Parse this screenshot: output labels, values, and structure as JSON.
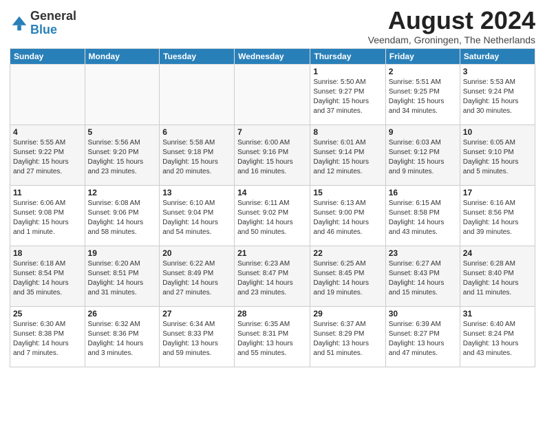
{
  "header": {
    "logo_line1": "General",
    "logo_line2": "Blue",
    "title": "August 2024",
    "subtitle": "Veendam, Groningen, The Netherlands"
  },
  "weekdays": [
    "Sunday",
    "Monday",
    "Tuesday",
    "Wednesday",
    "Thursday",
    "Friday",
    "Saturday"
  ],
  "weeks": [
    [
      {
        "day": "",
        "info": ""
      },
      {
        "day": "",
        "info": ""
      },
      {
        "day": "",
        "info": ""
      },
      {
        "day": "",
        "info": ""
      },
      {
        "day": "1",
        "info": "Sunrise: 5:50 AM\nSunset: 9:27 PM\nDaylight: 15 hours\nand 37 minutes."
      },
      {
        "day": "2",
        "info": "Sunrise: 5:51 AM\nSunset: 9:25 PM\nDaylight: 15 hours\nand 34 minutes."
      },
      {
        "day": "3",
        "info": "Sunrise: 5:53 AM\nSunset: 9:24 PM\nDaylight: 15 hours\nand 30 minutes."
      }
    ],
    [
      {
        "day": "4",
        "info": "Sunrise: 5:55 AM\nSunset: 9:22 PM\nDaylight: 15 hours\nand 27 minutes."
      },
      {
        "day": "5",
        "info": "Sunrise: 5:56 AM\nSunset: 9:20 PM\nDaylight: 15 hours\nand 23 minutes."
      },
      {
        "day": "6",
        "info": "Sunrise: 5:58 AM\nSunset: 9:18 PM\nDaylight: 15 hours\nand 20 minutes."
      },
      {
        "day": "7",
        "info": "Sunrise: 6:00 AM\nSunset: 9:16 PM\nDaylight: 15 hours\nand 16 minutes."
      },
      {
        "day": "8",
        "info": "Sunrise: 6:01 AM\nSunset: 9:14 PM\nDaylight: 15 hours\nand 12 minutes."
      },
      {
        "day": "9",
        "info": "Sunrise: 6:03 AM\nSunset: 9:12 PM\nDaylight: 15 hours\nand 9 minutes."
      },
      {
        "day": "10",
        "info": "Sunrise: 6:05 AM\nSunset: 9:10 PM\nDaylight: 15 hours\nand 5 minutes."
      }
    ],
    [
      {
        "day": "11",
        "info": "Sunrise: 6:06 AM\nSunset: 9:08 PM\nDaylight: 15 hours\nand 1 minute."
      },
      {
        "day": "12",
        "info": "Sunrise: 6:08 AM\nSunset: 9:06 PM\nDaylight: 14 hours\nand 58 minutes."
      },
      {
        "day": "13",
        "info": "Sunrise: 6:10 AM\nSunset: 9:04 PM\nDaylight: 14 hours\nand 54 minutes."
      },
      {
        "day": "14",
        "info": "Sunrise: 6:11 AM\nSunset: 9:02 PM\nDaylight: 14 hours\nand 50 minutes."
      },
      {
        "day": "15",
        "info": "Sunrise: 6:13 AM\nSunset: 9:00 PM\nDaylight: 14 hours\nand 46 minutes."
      },
      {
        "day": "16",
        "info": "Sunrise: 6:15 AM\nSunset: 8:58 PM\nDaylight: 14 hours\nand 43 minutes."
      },
      {
        "day": "17",
        "info": "Sunrise: 6:16 AM\nSunset: 8:56 PM\nDaylight: 14 hours\nand 39 minutes."
      }
    ],
    [
      {
        "day": "18",
        "info": "Sunrise: 6:18 AM\nSunset: 8:54 PM\nDaylight: 14 hours\nand 35 minutes."
      },
      {
        "day": "19",
        "info": "Sunrise: 6:20 AM\nSunset: 8:51 PM\nDaylight: 14 hours\nand 31 minutes."
      },
      {
        "day": "20",
        "info": "Sunrise: 6:22 AM\nSunset: 8:49 PM\nDaylight: 14 hours\nand 27 minutes."
      },
      {
        "day": "21",
        "info": "Sunrise: 6:23 AM\nSunset: 8:47 PM\nDaylight: 14 hours\nand 23 minutes."
      },
      {
        "day": "22",
        "info": "Sunrise: 6:25 AM\nSunset: 8:45 PM\nDaylight: 14 hours\nand 19 minutes."
      },
      {
        "day": "23",
        "info": "Sunrise: 6:27 AM\nSunset: 8:43 PM\nDaylight: 14 hours\nand 15 minutes."
      },
      {
        "day": "24",
        "info": "Sunrise: 6:28 AM\nSunset: 8:40 PM\nDaylight: 14 hours\nand 11 minutes."
      }
    ],
    [
      {
        "day": "25",
        "info": "Sunrise: 6:30 AM\nSunset: 8:38 PM\nDaylight: 14 hours\nand 7 minutes."
      },
      {
        "day": "26",
        "info": "Sunrise: 6:32 AM\nSunset: 8:36 PM\nDaylight: 14 hours\nand 3 minutes."
      },
      {
        "day": "27",
        "info": "Sunrise: 6:34 AM\nSunset: 8:33 PM\nDaylight: 13 hours\nand 59 minutes."
      },
      {
        "day": "28",
        "info": "Sunrise: 6:35 AM\nSunset: 8:31 PM\nDaylight: 13 hours\nand 55 minutes."
      },
      {
        "day": "29",
        "info": "Sunrise: 6:37 AM\nSunset: 8:29 PM\nDaylight: 13 hours\nand 51 minutes."
      },
      {
        "day": "30",
        "info": "Sunrise: 6:39 AM\nSunset: 8:27 PM\nDaylight: 13 hours\nand 47 minutes."
      },
      {
        "day": "31",
        "info": "Sunrise: 6:40 AM\nSunset: 8:24 PM\nDaylight: 13 hours\nand 43 minutes."
      }
    ]
  ]
}
